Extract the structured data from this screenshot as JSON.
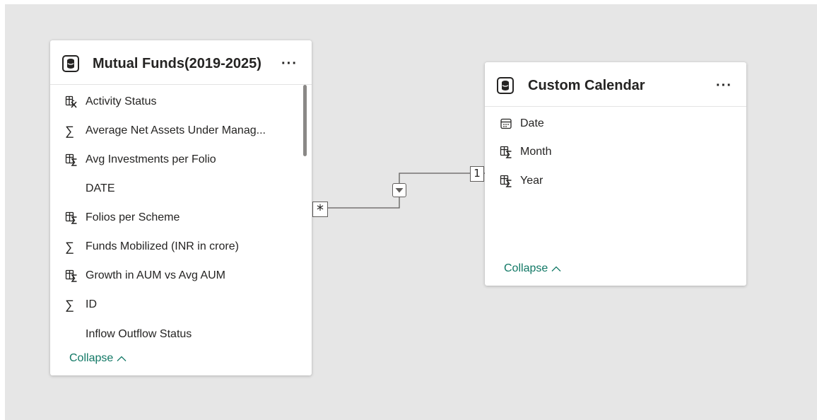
{
  "colors": {
    "canvas": "#e6e6e6",
    "card": "#ffffff",
    "text": "#252423",
    "collapse_link": "#117865",
    "relationship_line": "#605e5c"
  },
  "tables": {
    "mutual_funds": {
      "title": "Mutual Funds(2019-2025)",
      "icon": "database-icon",
      "more_label": "···",
      "collapse_label": "Collapse",
      "fields": [
        {
          "name": "Activity Status",
          "icon": "calculated-column-icon"
        },
        {
          "name": "Average Net Assets Under Manag...",
          "icon": "sigma-icon"
        },
        {
          "name": "Avg Investments per Folio",
          "icon": "measure-icon"
        },
        {
          "name": "DATE",
          "icon": ""
        },
        {
          "name": "Folios per Scheme",
          "icon": "measure-icon"
        },
        {
          "name": "Funds Mobilized (INR in crore)",
          "icon": "sigma-icon"
        },
        {
          "name": "Growth in AUM vs Avg AUM",
          "icon": "measure-icon"
        },
        {
          "name": "ID",
          "icon": "sigma-icon"
        },
        {
          "name": "Inflow Outflow Status",
          "icon": ""
        }
      ]
    },
    "custom_calendar": {
      "title": "Custom Calendar",
      "icon": "database-icon",
      "more_label": "···",
      "collapse_label": "Collapse",
      "fields": [
        {
          "name": "Date",
          "icon": "calendar-icon"
        },
        {
          "name": "Month",
          "icon": "measure-icon"
        },
        {
          "name": "Year",
          "icon": "measure-icon"
        }
      ]
    }
  },
  "relationship": {
    "many_label": "*",
    "one_label": "1",
    "direction_icon": "filter-direction-icon"
  }
}
